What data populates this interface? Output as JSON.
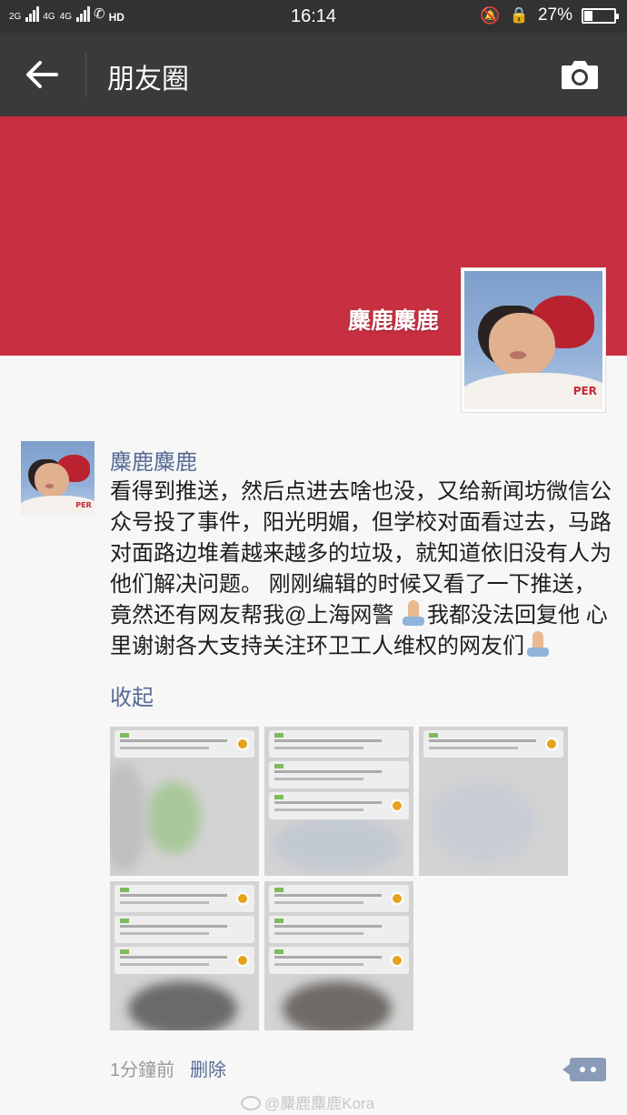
{
  "status_bar": {
    "network_1": "2G",
    "network_2": "4G",
    "network_3": "4G",
    "hd": "HD",
    "time": "16:14",
    "battery": "27%",
    "battery_level": 0.27
  },
  "app_bar": {
    "back_icon": "arrow-left-icon",
    "title": "朋友圈",
    "camera_icon": "camera-icon"
  },
  "profile": {
    "name": "麋鹿麋鹿",
    "cover_color": "#c82f40",
    "avatar_logo": "PER"
  },
  "post": {
    "author": "麋鹿麋鹿",
    "text_1": "看得到推送，然后点进去啥也没，又给新闻坊微信公众号投了事件，阳光明媚，但学校对面看过去，马路对面路边堆着越来越多的垃圾，就知道依旧没有人为他们解决问题。 刚刚编辑的时候又看了一下推送，竟然还有网友帮我@上海网警",
    "text_2": "我都没法回复他  心里谢谢各大支持关注环卫工人维权的网友们",
    "emoji": "folded-hands-icon",
    "collapse_label": "收起",
    "photo_count": 5,
    "time": "1分鐘前",
    "delete_label": "删除",
    "comment_icon": "comment-icon"
  },
  "watermark": "@麋鹿麋鹿Kora",
  "colors": {
    "link": "#576b95",
    "app_bar": "#3a3a3a",
    "status_bar": "#323232"
  }
}
